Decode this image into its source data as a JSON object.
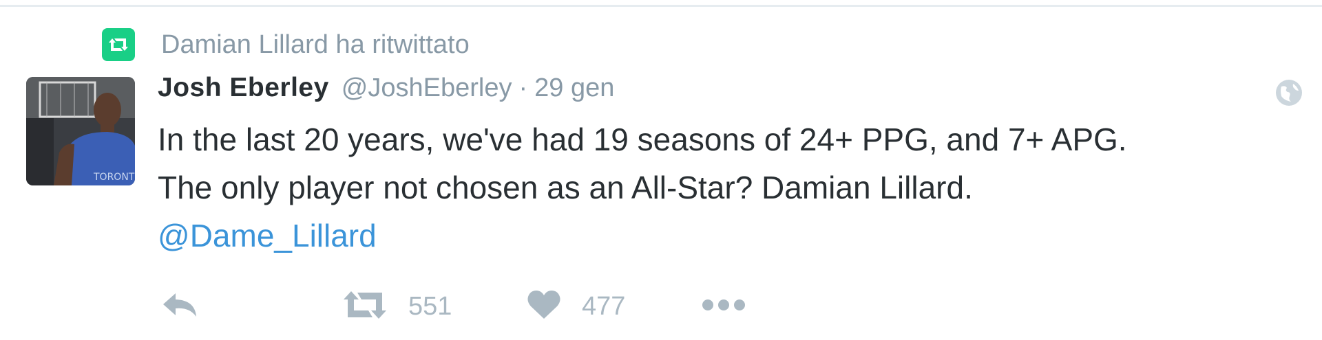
{
  "retweet_context": {
    "text": "Damian Lillard ha ritwittato",
    "badge_color": "#19cf86",
    "icon": "retweet-icon"
  },
  "tweet": {
    "fullname": "Josh Eberley",
    "username": "@JoshEberley",
    "separator": "·",
    "timestamp": "29 gen",
    "privacy_icon": "globe-icon",
    "lines": [
      "In the last 20 years, we've had 19 seasons of 24+ PPG, and 7+ APG.",
      "The only player not chosen as an All-Star? Damian Lillard."
    ],
    "mention": "@Dame_Lillard",
    "mention_color": "#3b94d9"
  },
  "actions": {
    "reply_icon": "reply-icon",
    "retweet_icon": "retweet-icon",
    "retweet_count": "551",
    "like_icon": "heart-icon",
    "like_count": "477",
    "more_icon": "more-icon"
  }
}
